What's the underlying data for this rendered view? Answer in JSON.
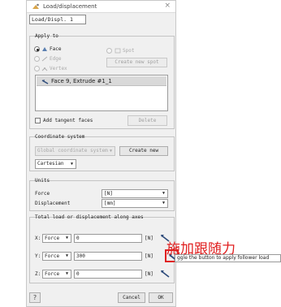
{
  "window": {
    "title": "Load/displacement",
    "close_glyph": "×"
  },
  "name_field": {
    "value": "Load/Displ. 1"
  },
  "apply_to": {
    "title": "Apply to",
    "options": [
      {
        "label": "Face",
        "checked": true,
        "enabled": true,
        "icon": "face-icon"
      },
      {
        "label": "Edge",
        "checked": false,
        "enabled": false,
        "icon": "edge-icon"
      },
      {
        "label": "Vertex",
        "checked": false,
        "enabled": false,
        "icon": "vertex-icon"
      },
      {
        "label": "Spot",
        "checked": false,
        "enabled": false,
        "icon": "spot-icon"
      }
    ],
    "create_spot_label": "Create new spot",
    "selection_list": [
      "Face 9, Extrude #1_1"
    ],
    "add_tangent_label": "Add tangent faces",
    "delete_label": "Delete"
  },
  "coordinate_system": {
    "title": "Coordinate system",
    "system_value": "Global coordinate system",
    "create_new_label": "Create new",
    "type_value": "Cartesian"
  },
  "units": {
    "title": "Units",
    "force_label": "Force",
    "force_value": "[N]",
    "displacement_label": "Displacement",
    "displacement_value": "[mm]"
  },
  "loads": {
    "title": "Total load or displacement along axes",
    "rows": [
      {
        "axis": "X:",
        "type": "Force",
        "value": "0",
        "unit": "[N]"
      },
      {
        "axis": "Y:",
        "type": "Force",
        "value": "300",
        "unit": "[N]"
      },
      {
        "axis": "Z:",
        "type": "Force",
        "value": "0",
        "unit": "[N]"
      }
    ]
  },
  "footer": {
    "help_label": "?",
    "cancel_label": "Cancel",
    "ok_label": "OK"
  },
  "annotation": {
    "text": "施加跟随力",
    "color": "#e02020"
  },
  "tooltip": {
    "text": "ggle the button to apply follower load"
  }
}
